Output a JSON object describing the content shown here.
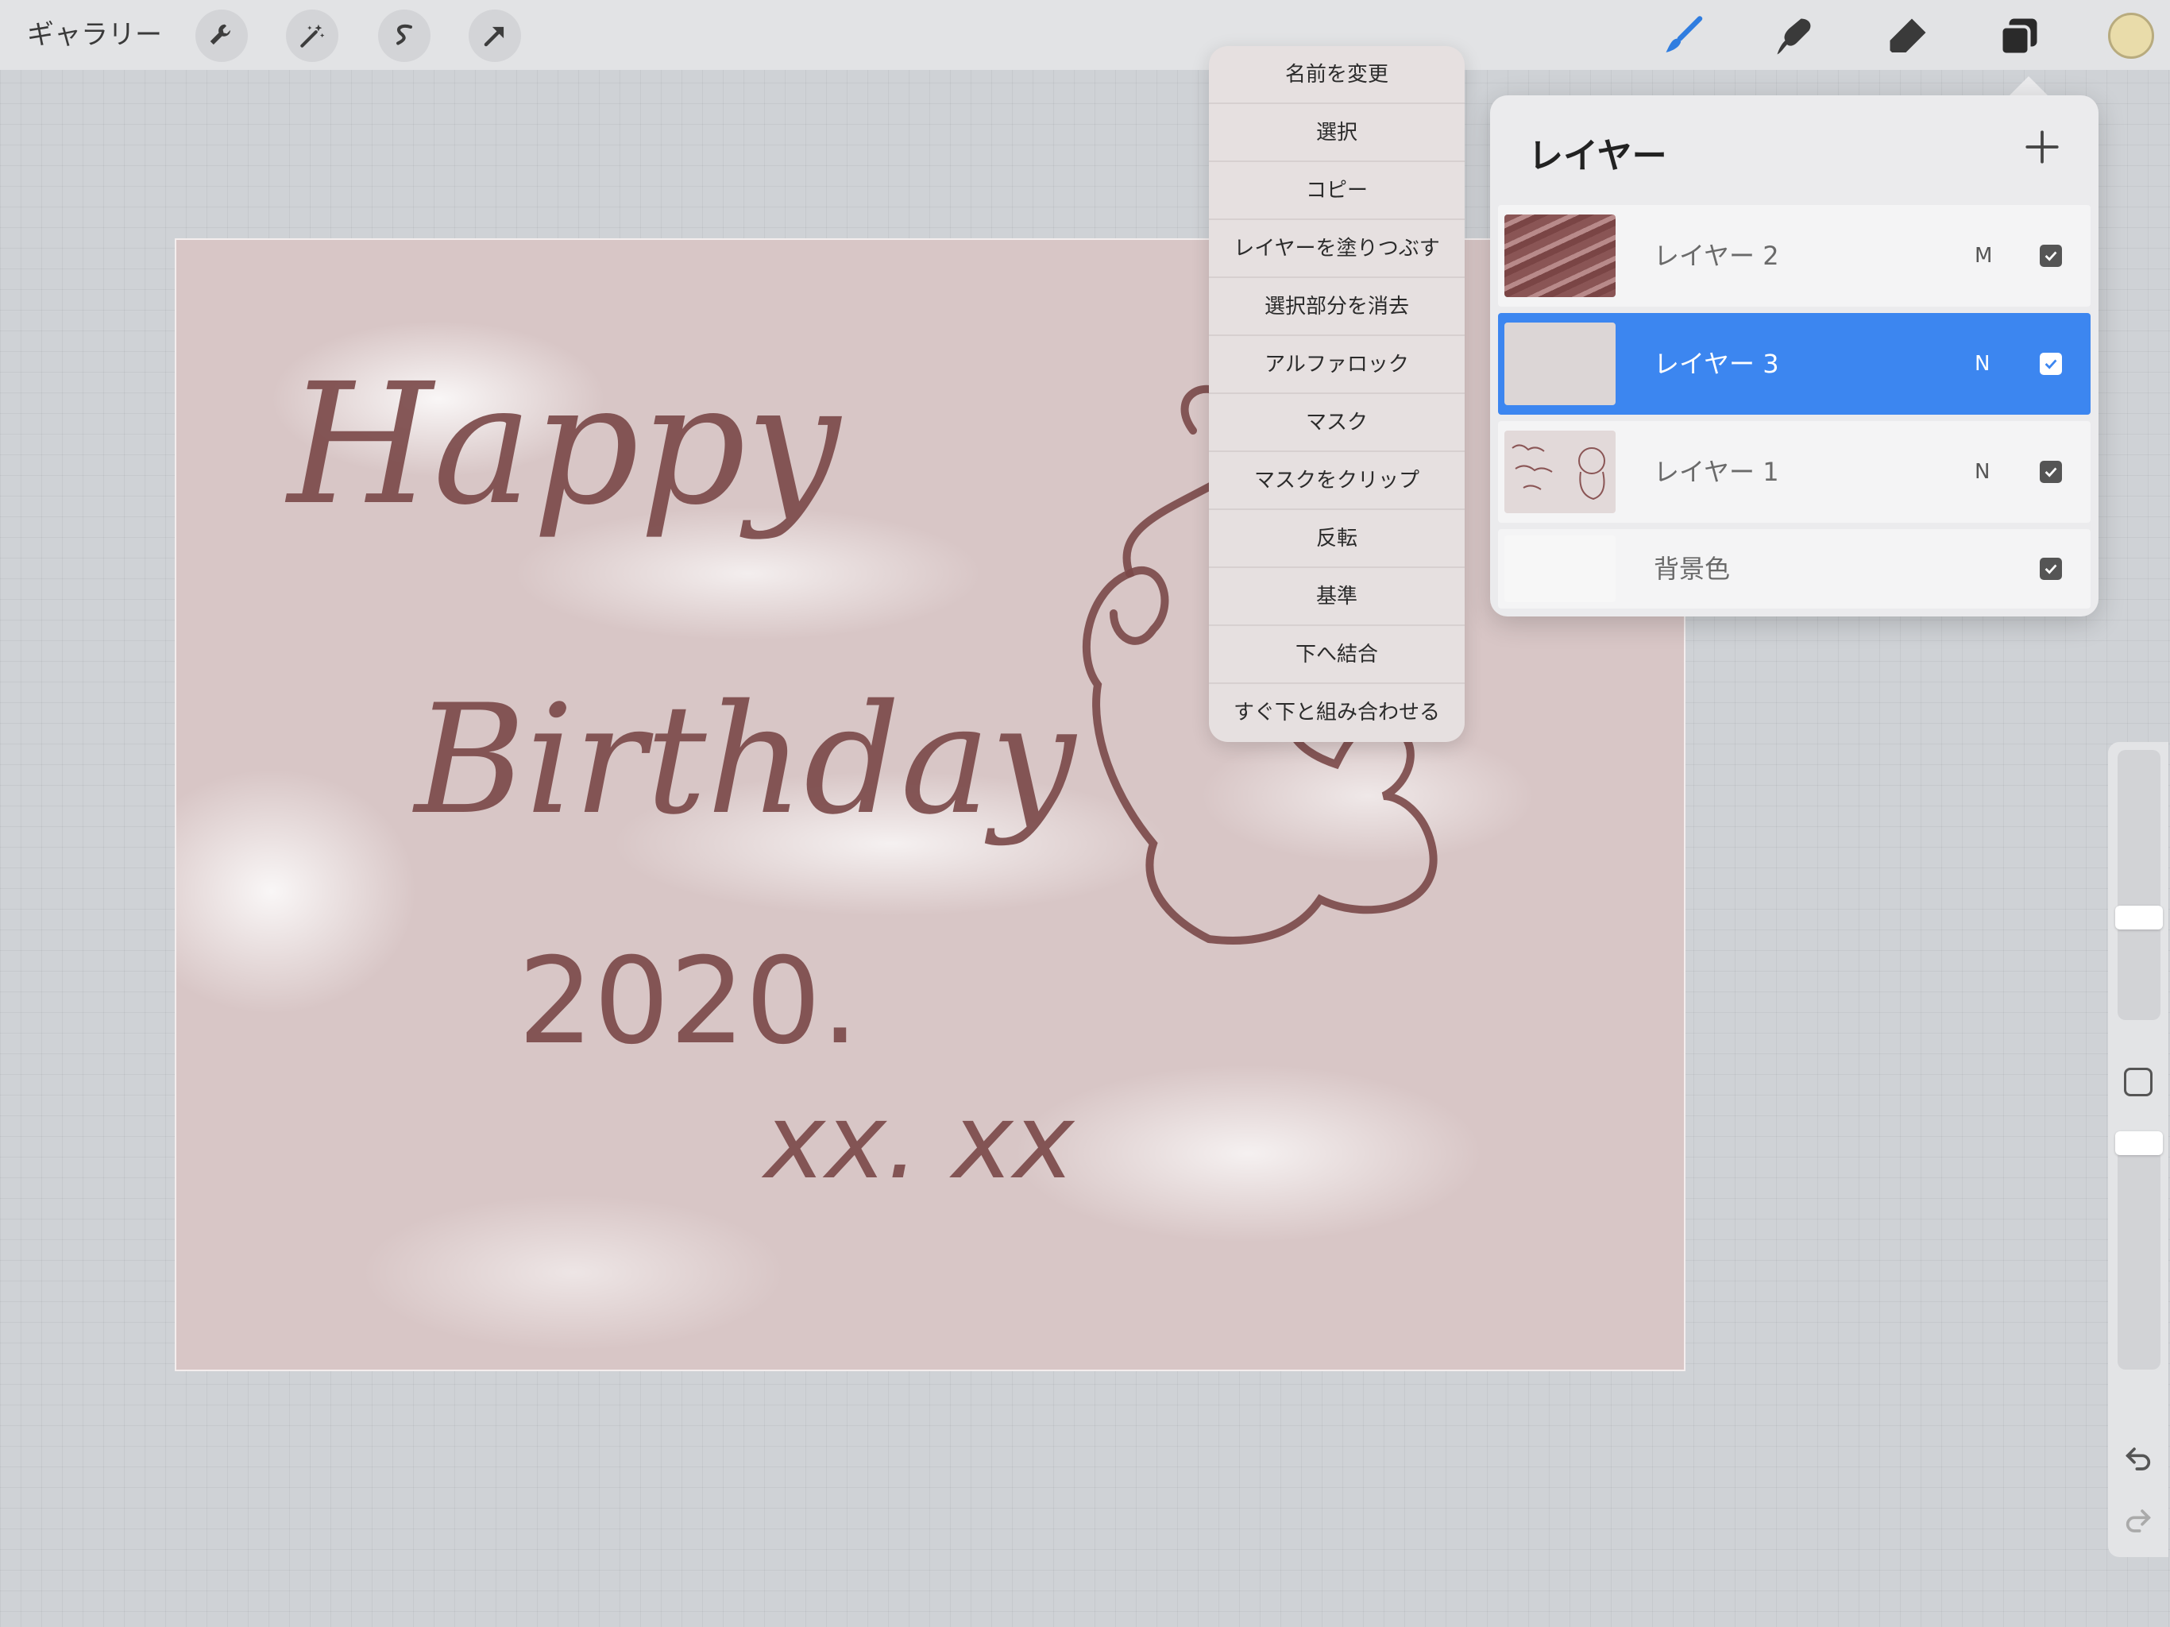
{
  "toolbar": {
    "gallery_label": "ギャラリー",
    "left_tools": [
      "wrench-icon",
      "magic-wand-icon",
      "selection-s-icon",
      "transform-arrow-icon"
    ],
    "right_tools": [
      "brush-icon",
      "smudge-icon",
      "eraser-icon",
      "layers-icon"
    ],
    "active_tool_color": "#2f7de0",
    "current_color": "#e9dcaa"
  },
  "context_menu": {
    "items": [
      "名前を変更",
      "選択",
      "コピー",
      "レイヤーを塗りつぶす",
      "選択部分を消去",
      "アルファロック",
      "マスク",
      "マスクをクリップ",
      "反転",
      "基準",
      "下へ結合",
      "すぐ下と組み合わせる"
    ]
  },
  "layers": {
    "title": "レイヤー",
    "items": [
      {
        "name": "レイヤー 2",
        "blend": "M",
        "checked": true,
        "selected": false
      },
      {
        "name": "レイヤー 3",
        "blend": "N",
        "checked": true,
        "selected": true
      },
      {
        "name": "レイヤー 1",
        "blend": "N",
        "checked": true,
        "selected": false
      },
      {
        "name": "背景色",
        "blend": "",
        "checked": true,
        "selected": false
      }
    ],
    "selected_color": "#3c86f0"
  },
  "canvas": {
    "background_color": "#d8c6c6",
    "ink_color": "#7a4848",
    "text_lines": [
      "Happy",
      "Birthday",
      "2020.",
      "xx. xx"
    ]
  }
}
